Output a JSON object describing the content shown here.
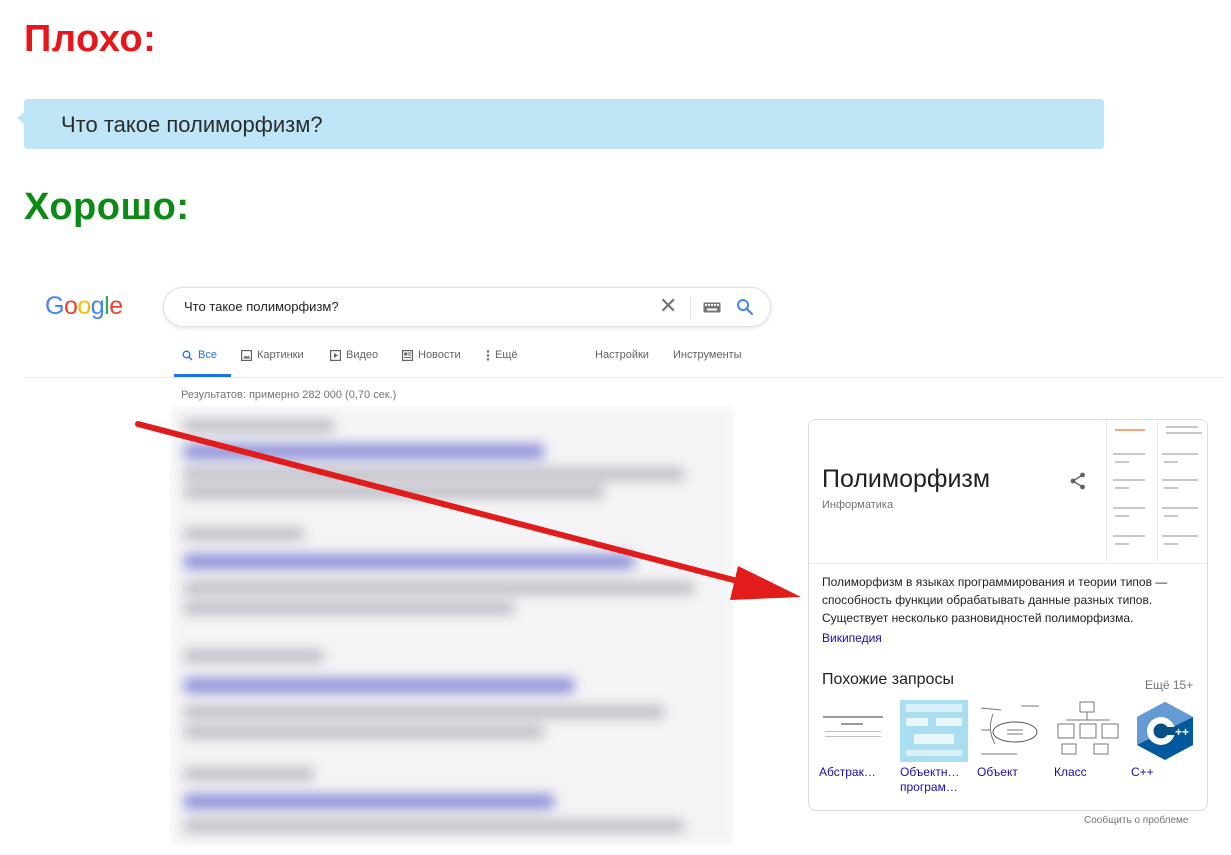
{
  "bad": {
    "heading": "Плохо:",
    "question": "Что такое полиморфизм?"
  },
  "good": {
    "heading": "Хорошо:"
  },
  "google": {
    "logo_letters": [
      {
        "ch": "G",
        "color": "#4285f4"
      },
      {
        "ch": "o",
        "color": "#ea4335"
      },
      {
        "ch": "o",
        "color": "#fbbc05"
      },
      {
        "ch": "g",
        "color": "#4285f4"
      },
      {
        "ch": "l",
        "color": "#34a853"
      },
      {
        "ch": "e",
        "color": "#ea4335"
      }
    ],
    "search_value": "Что такое полиморфизм?",
    "tabs": [
      "Все",
      "Картинки",
      "Видео",
      "Новости",
      "Ещё"
    ],
    "active_tab": "Все",
    "settings": "Настройки",
    "tools": "Инструменты",
    "results_count": "Результатов: примерно 282 000 (0,70 сек.)",
    "accent_color": "#1a73e8"
  },
  "knowledge_panel": {
    "title": "Полиморфизм",
    "subtitle": "Информатика",
    "description": "Полиморфизм в языках программирования и теории типов — способность функции обрабатывать данные разных типов. Существует несколько разновидностей полиморфизма.",
    "source": "Википедия",
    "related_heading": "Похожие запросы",
    "more": "Ещё 15+",
    "related": [
      {
        "label": "Абстрак…"
      },
      {
        "label": "Объектн… програм…"
      },
      {
        "label": "Объект"
      },
      {
        "label": "Класс"
      },
      {
        "label": "C++"
      }
    ],
    "report": "Сообщить о проблеме"
  },
  "arrow_color": "#e21b1b"
}
